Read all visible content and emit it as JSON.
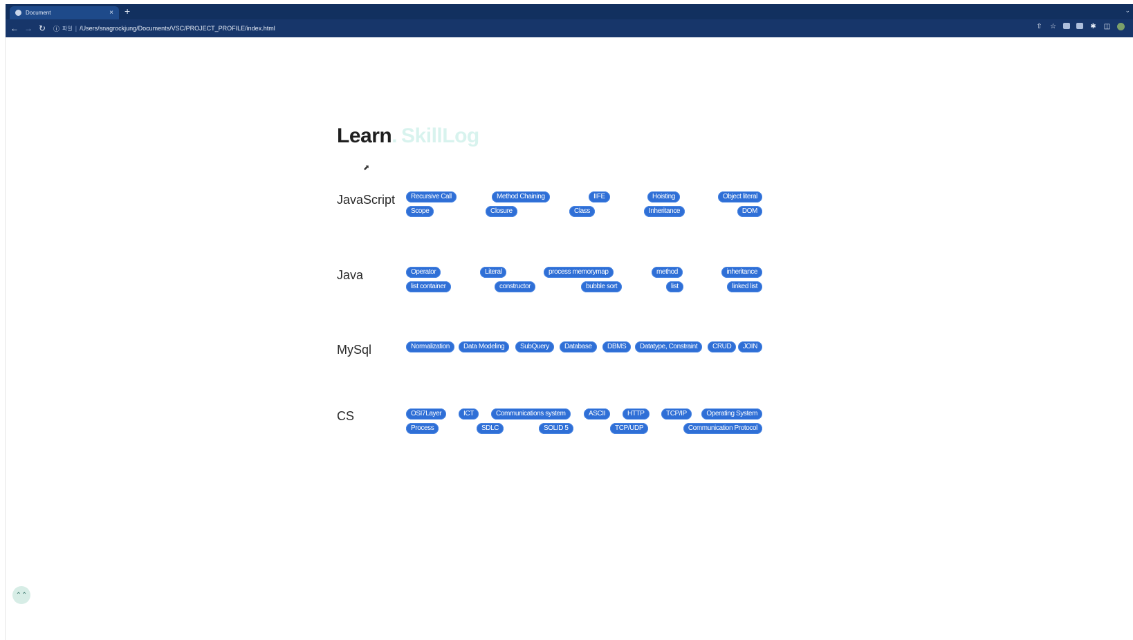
{
  "browser": {
    "tab_title": "Document",
    "tab_close": "×",
    "new_tab": "+",
    "tab_menu": "⌄",
    "url_scheme": "파일",
    "url": "/Users/snagrockjung/Documents/VSC/PROJECT_PROFILE/index.html"
  },
  "header": {
    "learn": "Learn",
    "dot": ".",
    "skilllog": "SkillLog"
  },
  "sections": {
    "javascript": {
      "title": "JavaScript",
      "row1": [
        "Recursive Call",
        "Method Chaining",
        "IIFE",
        "Hoisting",
        "Object literal"
      ],
      "row2": [
        "Scope",
        "Closure",
        "Class",
        "Inheritance",
        "DOM"
      ]
    },
    "java": {
      "title": "Java",
      "row1": [
        "Operator",
        "Literal",
        "process memorymap",
        "method",
        "inheritance"
      ],
      "row2": [
        "list container",
        "constructor",
        "bubble sort",
        "list",
        "linked list"
      ]
    },
    "mysql": {
      "title": "MySql",
      "row1": [
        "Normalization",
        "Data Modeling",
        "SubQuery",
        "Database",
        "DBMS",
        "Datatype, Constraint",
        "CRUD",
        "JOIN"
      ]
    },
    "cs": {
      "title": "CS",
      "row1": [
        "OSI7Layer",
        "ICT",
        "Communications system",
        "ASCII",
        "HTTP",
        "TCP/IP",
        "Operating System"
      ],
      "row2": [
        "Process",
        "SDLC",
        "SOLID 5",
        "TCP/UDP",
        "Communication Protocol"
      ]
    }
  },
  "scroll_top_icon": "double-chevron-up-icon"
}
